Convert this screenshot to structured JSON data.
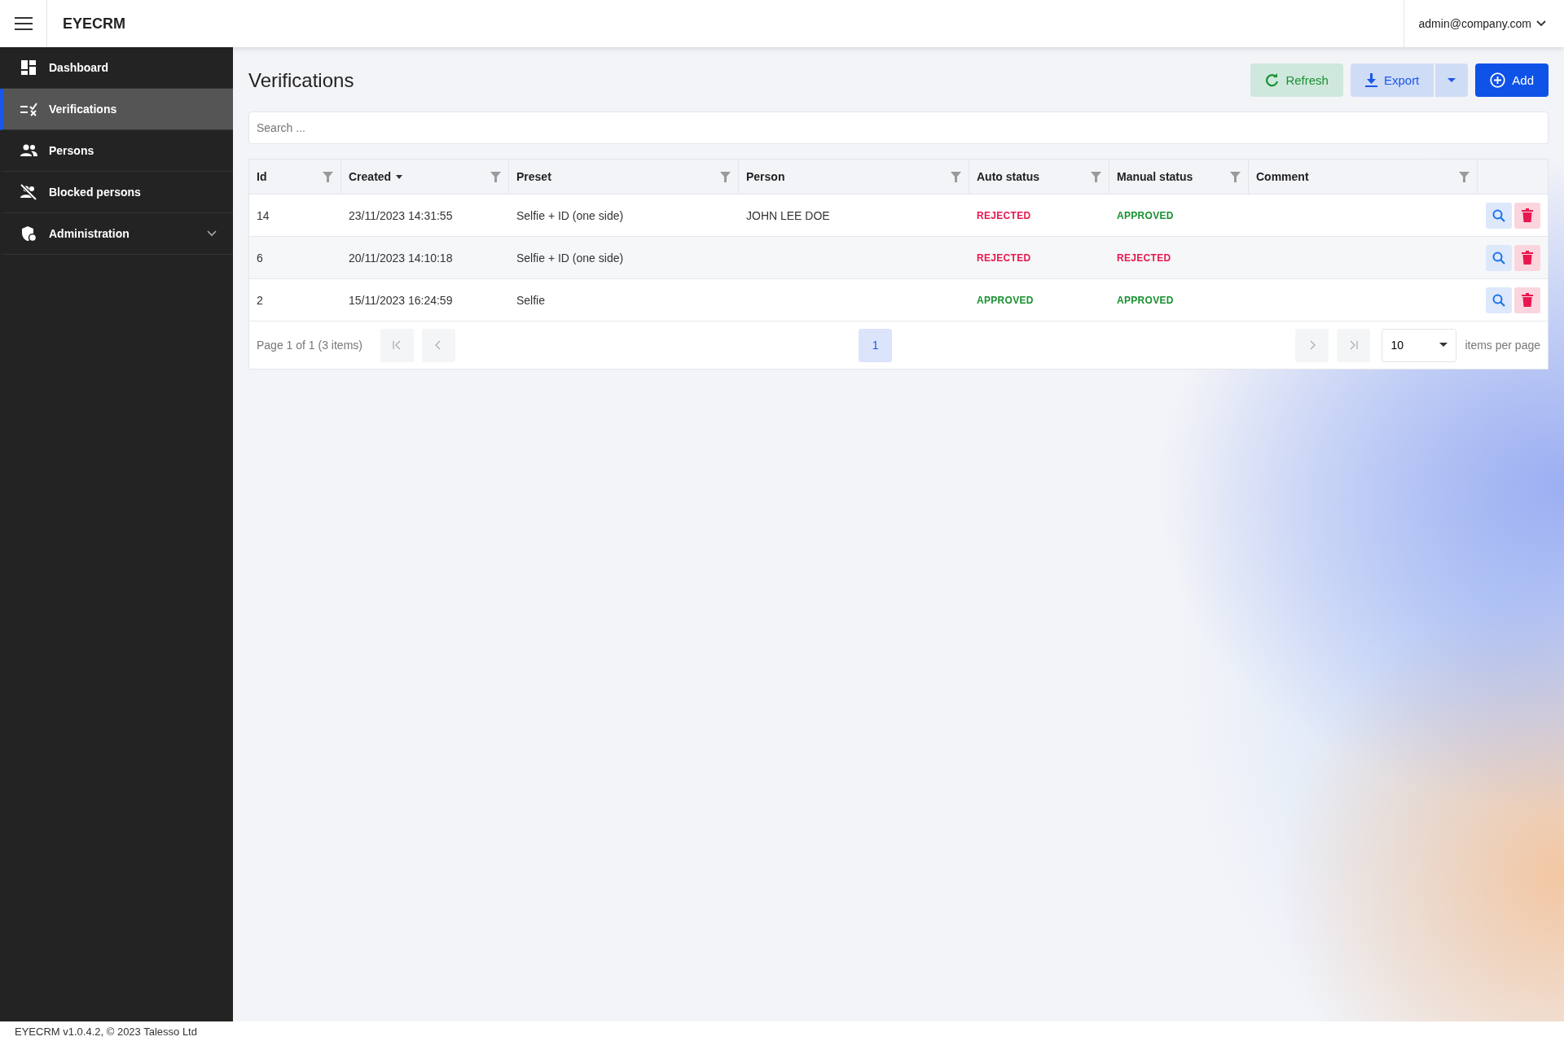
{
  "header": {
    "app_name": "EYECRM",
    "user": "admin@company.com"
  },
  "sidebar": {
    "items": [
      {
        "label": "Dashboard",
        "selected": false
      },
      {
        "label": "Verifications",
        "selected": true
      },
      {
        "label": "Persons",
        "selected": false
      },
      {
        "label": "Blocked persons",
        "selected": false
      },
      {
        "label": "Administration",
        "selected": false,
        "expanded": false
      }
    ]
  },
  "page": {
    "title": "Verifications",
    "buttons": [
      {
        "label": "Refresh",
        "kind": "refresh"
      },
      {
        "label": "Export",
        "kind": "export"
      },
      {
        "label": "Add",
        "kind": "add"
      }
    ]
  },
  "search": {
    "placeholder": "Search ..."
  },
  "table": {
    "columns": [
      {
        "label": "Id",
        "sorted": false
      },
      {
        "label": "Created",
        "sorted": true
      },
      {
        "label": "Preset",
        "sorted": false
      },
      {
        "label": "Person",
        "sorted": false
      },
      {
        "label": "Auto status",
        "sorted": false
      },
      {
        "label": "Manual status",
        "sorted": false
      },
      {
        "label": "Comment",
        "sorted": false
      }
    ],
    "rows": [
      {
        "id": "14",
        "created": "23/11/2023 14:31:55",
        "preset": "Selfie + ID (one side)",
        "person": "JOHN LEE DOE",
        "auto_status": {
          "text": "REJECTED",
          "kind": "rejected"
        },
        "manual_status": {
          "text": "APPROVED",
          "kind": "approved"
        }
      },
      {
        "id": "6",
        "created": "20/11/2023 14:10:18",
        "preset": "Selfie + ID (one side)",
        "person": "",
        "auto_status": {
          "text": "REJECTED",
          "kind": "rejected"
        },
        "manual_status": {
          "text": "REJECTED",
          "kind": "rejected"
        }
      },
      {
        "id": "2",
        "created": "15/11/2023 16:24:59",
        "preset": "Selfie",
        "person": "",
        "auto_status": {
          "text": "APPROVED",
          "kind": "approved"
        },
        "manual_status": {
          "text": "APPROVED",
          "kind": "approved"
        }
      }
    ]
  },
  "pager": {
    "summary": "Page 1 of 1 (3 items)",
    "first_disabled": true,
    "prev_disabled": true,
    "next_disabled": true,
    "last_disabled": true,
    "pages": [
      {
        "label": "1",
        "selected": true
      }
    ],
    "page_size": "10",
    "page_size_label": "items per page"
  },
  "footer": {
    "text": "EYECRM v1.0.4.2, © 2023 Talesso Ltd"
  }
}
